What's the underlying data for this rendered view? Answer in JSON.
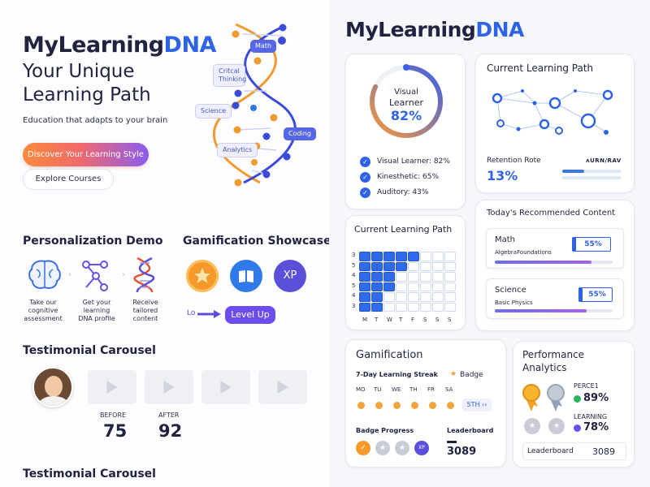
{
  "left": {
    "brand": {
      "part1": "MyLearning",
      "part2": "DNA"
    },
    "hero_title_line1": "Your Unique",
    "hero_title_line2": "Learning Path",
    "hero_subtitle": "Education that adapts to your brain",
    "cta_primary": "Discover Your Learning Style",
    "cta_secondary": "Explore Courses",
    "dna_labels": {
      "math": "Math",
      "critical": "Critcal\nThinking",
      "science": "Science",
      "coding": "Coding",
      "analytics": "Analytics"
    },
    "personalization": {
      "title": "Personalization Demo",
      "steps": [
        {
          "label": "Take our cognitive assessment",
          "icon": "brain-icon"
        },
        {
          "label": "Get your learning DNA profile",
          "icon": "network-icon"
        },
        {
          "label": "Receive tailored content",
          "icon": "dna-icon"
        }
      ]
    },
    "gamification": {
      "title": "Gamification Showcase",
      "badges": [
        {
          "icon": "star-badge-icon",
          "color": "#f59a2a"
        },
        {
          "icon": "book-badge-icon",
          "color": "#2f7ae8"
        },
        {
          "icon": "xp-badge-icon",
          "label": "XP",
          "color": "#5a4fd8"
        }
      ],
      "level_prefix": "Lo",
      "level_button": "Level Up"
    },
    "testimonial": {
      "title": "Testimonial Carousel",
      "before_label": "BEFORE",
      "before_value": "75",
      "after_label": "AFTER",
      "after_value": "92"
    },
    "testimonial2_title": "Testimonial Carousel"
  },
  "right": {
    "brand": {
      "part1": "MyLearning",
      "part2": "DNA"
    },
    "profile": {
      "title_line1": "Visual",
      "title_line2": "Learner",
      "percent": "82%",
      "gauge_value": 0.82,
      "items": [
        {
          "label": "Visual Learner:",
          "value": "82%"
        },
        {
          "label": "Kinesthetic:",
          "value": "65%"
        },
        {
          "label": "Auditory:",
          "value": "43%"
        }
      ]
    },
    "path_network": {
      "title": "Current Learning Path",
      "retention_label": "Retention Rote",
      "retention_value": "13%",
      "retention_progress": 0.38,
      "retention_logo": "ᴧURN/RAV"
    },
    "heatmap": {
      "title": "Current Learning Path",
      "y_labels": [
        "3",
        "5",
        "4",
        "5",
        "4",
        "3"
      ],
      "x_labels": [
        "M",
        "T",
        "W",
        "T",
        "F",
        "S",
        "S",
        "S"
      ]
    },
    "recommended": {
      "title": "Today's Recommended Content",
      "items": [
        {
          "title": "Math",
          "subtitle": "AlgebraFoundations",
          "pct": "55%",
          "progress": 0.82
        },
        {
          "title": "Science",
          "subtitle": "Basic Physics",
          "pct": "55%",
          "progress": 0.78
        }
      ]
    },
    "gamification": {
      "title": "Gamification",
      "streak_label": "7-Day Learning Streak",
      "badge_label": "Badge",
      "days": [
        "MO",
        "TU",
        "WE",
        "TH",
        "FR",
        "SA"
      ],
      "streak_button": "5TH",
      "badge_progress_label": "Badge Progress",
      "leaderboard_label": "Leaderboard",
      "leaderboard_value": "3089"
    },
    "performance": {
      "title_line1": "Performance",
      "title_line2": "Analytics",
      "metric1_label": "PERCE1",
      "metric1_value": "89%",
      "metric2_label": "LEARNING",
      "metric2_value": "78%",
      "leaderboard_label": "Leaderboard",
      "leaderboard_value": "3089"
    }
  }
}
